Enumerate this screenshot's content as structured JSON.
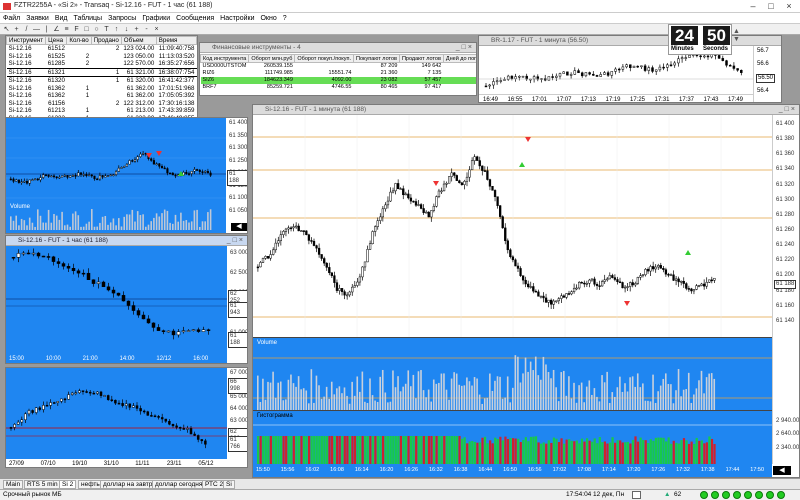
{
  "app": {
    "title": "FZTR2255A - «Si 2» - Transaq - Si-12.16 - FUT - 1 час (61 188)",
    "menu": [
      "Файл",
      "Заявки",
      "Вид",
      "Таблицы",
      "Запросы",
      "Графики",
      "Сообщения",
      "Настройки",
      "Окно",
      "?"
    ]
  },
  "trades": {
    "headers": [
      "Инструмент",
      "Цена",
      "Кол-во",
      "Продано",
      "Объем",
      "Время"
    ],
    "rows": [
      [
        "Si-12.16",
        "61512",
        "",
        "2",
        "123 024.00",
        "11:09:40:758"
      ],
      [
        "Si-12.16",
        "61525",
        "2",
        "",
        "123 050.00",
        "11:13:03:520"
      ],
      [
        "Si-12.16",
        "61285",
        "2",
        "",
        "122 570.00",
        "16:35:27:656"
      ],
      [
        "Si-12.16",
        "61321",
        "",
        "1",
        "61 321.00",
        "16:38:07:754"
      ],
      [
        "Si-12.16",
        "61320",
        "",
        "1",
        "61 320.00",
        "16:41:42:377"
      ],
      [
        "Si-12.16",
        "61362",
        "1",
        "",
        "61 362.00",
        "17:01:51:968"
      ],
      [
        "Si-12.16",
        "61362",
        "1",
        "",
        "61 362.00",
        "17:05:05:392"
      ],
      [
        "Si-12.16",
        "61156",
        "",
        "2",
        "122 312.00",
        "17:30:16:138"
      ],
      [
        "Si-12.16",
        "61213",
        "1",
        "",
        "61 213.00",
        "17:43:39:859"
      ],
      [
        "Si-12.16",
        "61232",
        "1",
        "",
        "61 232.00",
        "17:46:49:855"
      ]
    ]
  },
  "fin": {
    "title": "Финансовые инструменты - 4",
    "headers": [
      "Код инструмента",
      "Оборот млн.руб",
      "Оборот покуп./покуп.",
      "Покупают лотов",
      "Продают лотов",
      "Дней до погаш."
    ],
    "rows": [
      [
        "USD000UTSTOM",
        "260539.155",
        "",
        "87 209",
        "149 642",
        ""
      ],
      [
        "RIZ6",
        "111749.985",
        "15551.74",
        "21 360",
        "7 135",
        "3"
      ],
      [
        "SIZ6",
        "184623.349",
        "4092.00",
        "23 082",
        "57 457",
        "3"
      ],
      [
        "BRF7",
        "85259.721",
        "4746.55",
        "80 465",
        "97 417",
        "18"
      ]
    ]
  },
  "timer": {
    "minutes": "24",
    "seconds": "50",
    "min_label": "Minutes",
    "sec_label": "Seconds"
  },
  "br_chart": {
    "title": "BR-1.17 - FUT - 1 минута (56.50)",
    "prices": [
      "56.7",
      "56.6",
      "56.50",
      "56.4"
    ],
    "times": [
      "16:49",
      "16:55",
      "17:01",
      "17:07",
      "17:13",
      "17:19",
      "17:25",
      "17:31",
      "17:37",
      "17:43",
      "17:49"
    ]
  },
  "chart_a": {
    "volume_label": "Volume",
    "prices": [
      "61 400",
      "61 350",
      "61 300",
      "61 250",
      "61 200",
      "61 150",
      "61 100",
      "61 050"
    ],
    "last": "61 188"
  },
  "chart_b": {
    "title": "Si-12.16 - FUT - 1 час (61 188)",
    "prices": [
      "63 000",
      "62 500",
      "62 000",
      "61 500",
      "61 000"
    ],
    "mark1": "62 252",
    "mark2": "61 943",
    "last": "61 188",
    "dates": [
      "15:00",
      "10:00",
      "21:00",
      "14:00",
      "12/12",
      "16:00"
    ]
  },
  "chart_c": {
    "prices": [
      "67 000",
      "66 000",
      "65 000",
      "64 000",
      "63 000",
      "62 000",
      "61 000"
    ],
    "mark1": "66 998",
    "mark2": "62 388",
    "mark3": "61 766",
    "dates": [
      "27/09",
      "07/10",
      "19/10",
      "31/10",
      "11/11",
      "23/11",
      "05/12"
    ]
  },
  "main_chart": {
    "title": "Si-12.16 - FUT - 1 минута (61 188)",
    "prices": [
      "61 400",
      "61 380",
      "61 360",
      "61 340",
      "61 320",
      "61 300",
      "61 280",
      "61 260",
      "61 240",
      "61 220",
      "61 200",
      "61 180",
      "61 160",
      "61 140"
    ],
    "levels": [
      "61 394",
      "61 350",
      "61 280",
      "61 145"
    ],
    "last": "61 188",
    "volume_label": "Volume",
    "vol_marks": [
      "12 000.00254",
      "1 800.00000"
    ],
    "hist_label": "Гистограмма",
    "hist_marks": [
      "2 940.00",
      "2 640.00",
      "2 340.00"
    ],
    "times": [
      "15:50",
      "15:56",
      "16:02",
      "16:08",
      "16:14",
      "16:20",
      "16:26",
      "16:32",
      "16:38",
      "16:44",
      "16:50",
      "16:56",
      "17:02",
      "17:08",
      "17:14",
      "17:20",
      "17:26",
      "17:32",
      "17:38",
      "17:44",
      "17:50"
    ]
  },
  "tabs": [
    "Main",
    "RTS 5 min",
    "Si 2",
    "нефть",
    "доллар на завтра",
    "доллар сегодня",
    "РТС 2",
    "Si"
  ],
  "status": {
    "left": "Срочный рынок МБ",
    "clock": "17:54:04",
    "date": "12 дек, Пн",
    "count": "62"
  }
}
